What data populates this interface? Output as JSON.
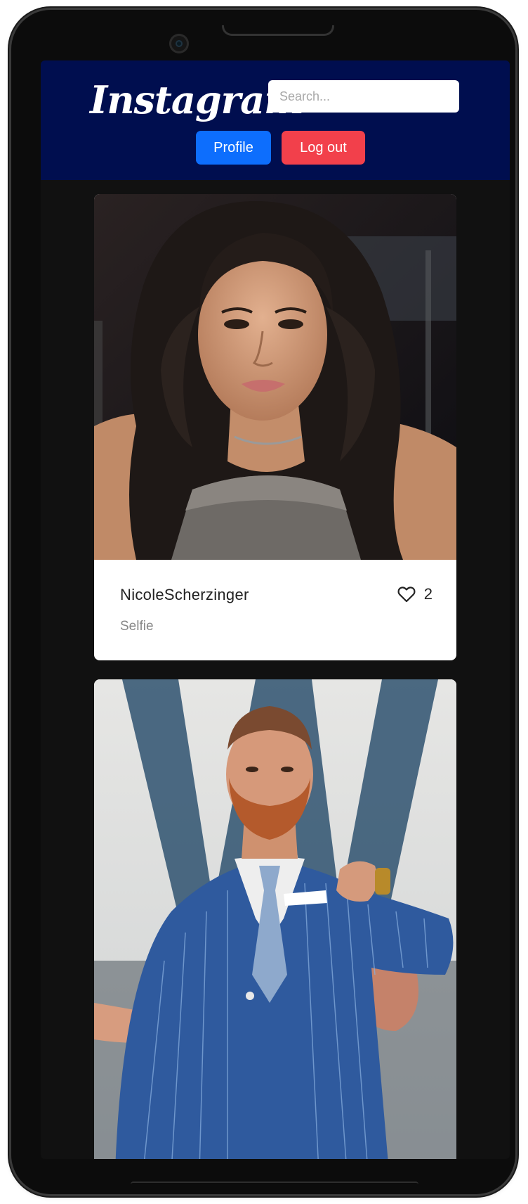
{
  "header": {
    "logo": "Instagram",
    "search_placeholder": "Search...",
    "profile_label": "Profile",
    "logout_label": "Log out",
    "background": "#000e4f"
  },
  "posts": [
    {
      "author": "NicoleScherzinger",
      "caption": "Selfie",
      "likes": "2",
      "like_icon": "heart-outline-icon"
    },
    {
      "author": "",
      "caption": "",
      "likes": ""
    }
  ],
  "colors": {
    "primary_button": "#0d6efd",
    "danger_button": "#f2404b",
    "feed_background": "#111111"
  }
}
